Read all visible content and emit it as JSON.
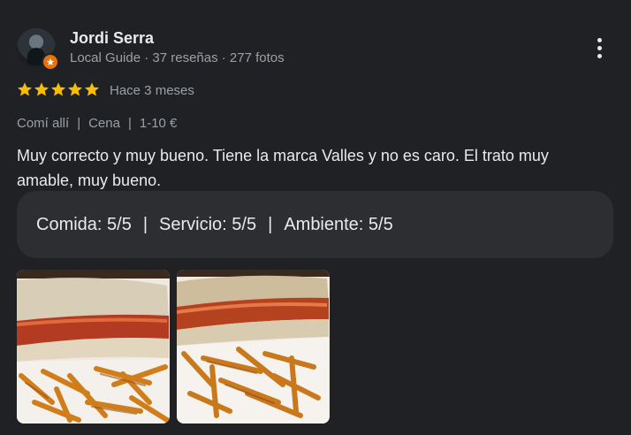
{
  "reviewer": {
    "name": "Jordi Serra",
    "meta": "Local Guide · 37 reseñas · 277 fotos",
    "avatar_icon": "profile-avatar",
    "badge_icon": "local-guide-star-badge",
    "badge_color": "#e8710a"
  },
  "menu_icon": "more-vert-icon",
  "rating": {
    "stars": 5,
    "star_color": "#fbbc04",
    "time_ago": "Hace 3 meses"
  },
  "tags": [
    "Comí allí",
    "Cena",
    "1-10 €"
  ],
  "tag_separator": "|",
  "review_text": "Muy correcto y muy bueno. Tiene la marca Valles y no es caro. El trato muy amable, muy bueno.",
  "sub_ratings": [
    "Comida: 5/5",
    "Servicio: 5/5",
    "Ambiente: 5/5"
  ],
  "photos": [
    {
      "icon": "photo-hotdog-fries-1"
    },
    {
      "icon": "photo-hotdog-fries-2"
    }
  ]
}
